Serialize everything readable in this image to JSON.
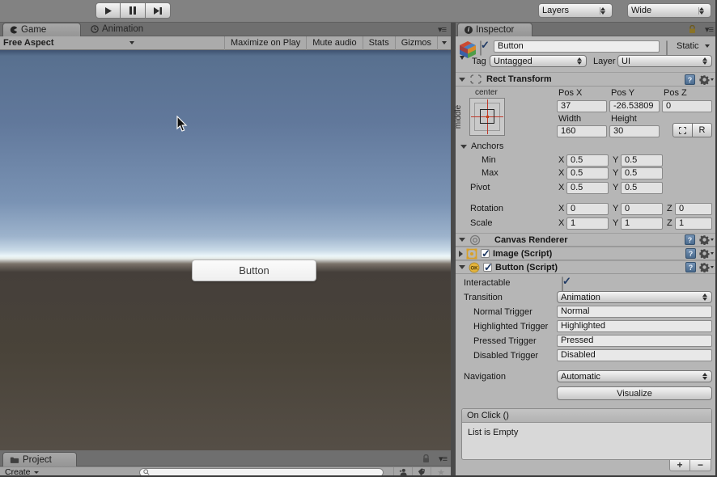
{
  "toolbar": {
    "layers_label": "Layers",
    "wide_label": "Wide"
  },
  "game_panel": {
    "tab_game": "Game",
    "tab_animation": "Animation",
    "aspect_value": "Free Aspect",
    "maximize_label": "Maximize on Play",
    "mute_label": "Mute audio",
    "stats_label": "Stats",
    "gizmos_label": "Gizmos",
    "scene_button_label": "Button"
  },
  "inspector": {
    "tab_label": "Inspector",
    "name_value": "Button",
    "static_label": "Static",
    "tag_label": "Tag",
    "tag_value": "Untagged",
    "layer_label": "Layer",
    "layer_value": "UI",
    "rect_transform": {
      "title": "Rect Transform",
      "anchor_h": "center",
      "anchor_v": "middle",
      "pos_x_label": "Pos X",
      "pos_x": "37",
      "pos_y_label": "Pos Y",
      "pos_y": "-26.53809",
      "pos_z_label": "Pos Z",
      "pos_z": "0",
      "width_label": "Width",
      "width": "160",
      "height_label": "Height",
      "height": "30",
      "r_button": "R",
      "anchors_label": "Anchors",
      "min": {
        "label": "Min",
        "x": "0.5",
        "y": "0.5"
      },
      "max": {
        "label": "Max",
        "x": "0.5",
        "y": "0.5"
      },
      "pivot": {
        "label": "Pivot",
        "x": "0.5",
        "y": "0.5"
      },
      "rotation": {
        "label": "Rotation",
        "x": "0",
        "y": "0",
        "z": "0"
      },
      "scale": {
        "label": "Scale",
        "x": "1",
        "y": "1",
        "z": "1"
      }
    },
    "canvas_renderer_title": "Canvas Renderer",
    "image_title": "Image (Script)",
    "button": {
      "title": "Button (Script)",
      "interactable_label": "Interactable",
      "transition_label": "Transition",
      "transition_value": "Animation",
      "triggers": [
        {
          "label": "Normal Trigger",
          "value": "Normal"
        },
        {
          "label": "Highlighted Trigger",
          "value": "Highlighted"
        },
        {
          "label": "Pressed Trigger",
          "value": "Pressed"
        },
        {
          "label": "Disabled Trigger",
          "value": "Disabled"
        }
      ],
      "navigation_label": "Navigation",
      "navigation_value": "Automatic",
      "visualize_label": "Visualize",
      "on_click_title": "On Click ()",
      "on_click_empty": "List is Empty",
      "add_label": "+",
      "remove_label": "−"
    },
    "xyz": {
      "x": "X",
      "y": "Y",
      "z": "Z"
    }
  },
  "project_panel": {
    "tab_label": "Project",
    "create_label": "Create"
  },
  "colors": {
    "sky_top": "#3e5170",
    "sky_horizon": "#ecf6fa",
    "ground": "#47413b",
    "panel_bg": "#b6b6b6"
  }
}
